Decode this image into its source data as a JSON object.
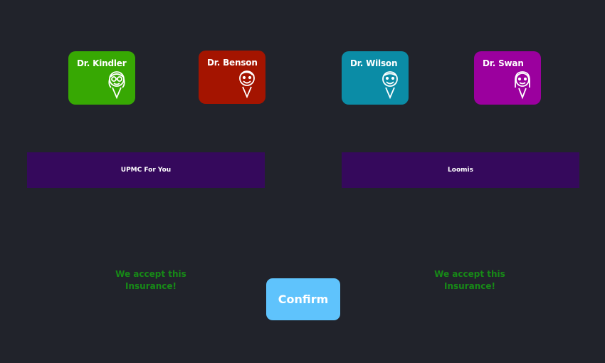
{
  "colors": {
    "background": "#21232b",
    "plan_bg": "#35095c",
    "accept_text": "#178a17",
    "confirm_bg": "#5fc3fc"
  },
  "doctors": [
    {
      "name": "Dr. Kindler",
      "color": "#37a803",
      "avatar_icon": "girl-with-glasses-icon"
    },
    {
      "name": "Dr. Benson",
      "color": "#a41400",
      "avatar_icon": "boy-smiling-icon"
    },
    {
      "name": "Dr. Wilson",
      "color": "#0b8ca6",
      "avatar_icon": "boy-smiling-icon"
    },
    {
      "name": "Dr. Swan",
      "color": "#9b009e",
      "avatar_icon": "girl-smiling-icon"
    }
  ],
  "insurance_plans": [
    {
      "label": "UPMC For You"
    },
    {
      "label": "Loomis"
    }
  ],
  "accept_messages": [
    {
      "line1": "We accept this",
      "line2": "Insurance!"
    },
    {
      "line1": "We accept this",
      "line2": "Insurance!"
    }
  ],
  "confirm_label": "Confirm"
}
